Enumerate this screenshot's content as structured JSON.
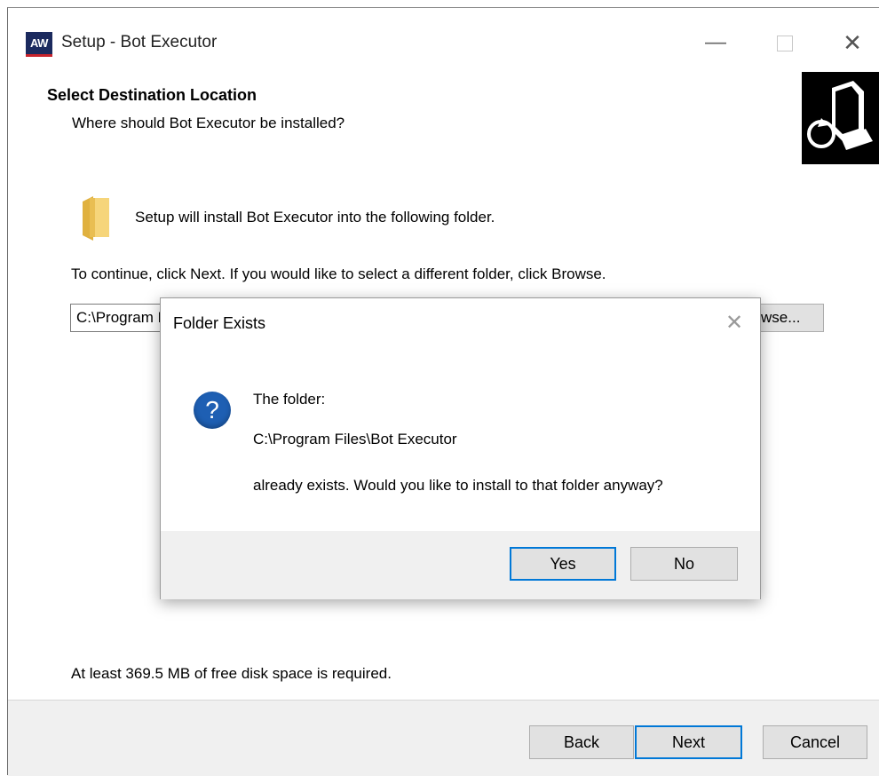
{
  "window": {
    "title": "Setup - Bot Executor",
    "app_icon_text": "AW",
    "minimize_glyph": "—",
    "close_glyph": "✕"
  },
  "header": {
    "title": "Select Destination Location",
    "subtitle": "Where should Bot Executor be installed?"
  },
  "body": {
    "install_line": "Setup will install Bot Executor into the following folder.",
    "instruction_line": "To continue, click Next. If you would like to select a different folder, click Browse.",
    "path_value": "C:\\Program Files\\Bot Executor",
    "browse_label": "Browse...",
    "disk_space": "At least 369.5 MB of free disk space is required."
  },
  "footer": {
    "back_label": "Back",
    "next_label": "Next",
    "cancel_label": "Cancel"
  },
  "dialog": {
    "title": "Folder Exists",
    "close_glyph": "✕",
    "icon_glyph": "?",
    "line1": "The folder:",
    "line2": "C:\\Program Files\\Bot Executor",
    "line3": "already exists. Would you like to install to that folder anyway?",
    "yes_label": "Yes",
    "no_label": "No"
  },
  "colors": {
    "accent_focus": "#0078d7",
    "question_icon": "#1e5fb3",
    "footer_bg": "#f0f0f0"
  }
}
